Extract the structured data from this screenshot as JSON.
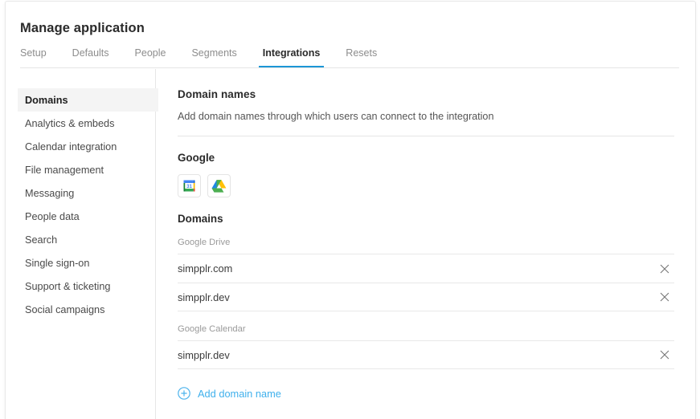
{
  "window": {
    "title": "Manage application"
  },
  "tabs": [
    {
      "label": "Setup",
      "active": false
    },
    {
      "label": "Defaults",
      "active": false
    },
    {
      "label": "People",
      "active": false
    },
    {
      "label": "Segments",
      "active": false
    },
    {
      "label": "Integrations",
      "active": true
    },
    {
      "label": "Resets",
      "active": false
    }
  ],
  "sidebar": {
    "items": [
      {
        "label": "Domains",
        "active": true
      },
      {
        "label": "Analytics & embeds",
        "active": false
      },
      {
        "label": "Calendar integration",
        "active": false
      },
      {
        "label": "File management",
        "active": false
      },
      {
        "label": "Messaging",
        "active": false
      },
      {
        "label": "People data",
        "active": false
      },
      {
        "label": "Search",
        "active": false
      },
      {
        "label": "Single sign-on",
        "active": false
      },
      {
        "label": "Support & ticketing",
        "active": false
      },
      {
        "label": "Social campaigns",
        "active": false
      }
    ]
  },
  "main": {
    "section_title": "Domain names",
    "section_description": "Add domain names through which users can connect to the integration",
    "provider_title": "Google",
    "integration_icons": [
      {
        "name": "google-calendar-icon",
        "label": "Google Calendar"
      },
      {
        "name": "google-drive-icon",
        "label": "Google Drive"
      }
    ],
    "domains_title": "Domains",
    "domain_groups": [
      {
        "label": "Google Drive",
        "rows": [
          {
            "value": "simpplr.com",
            "remove_icon": "close-icon"
          },
          {
            "value": "simpplr.dev",
            "remove_icon": "close-icon"
          }
        ]
      },
      {
        "label": "Google Calendar",
        "rows": [
          {
            "value": "simpplr.dev",
            "remove_icon": "close-icon"
          }
        ]
      }
    ],
    "add_domain": {
      "icon": "plus-circle-icon",
      "label": "Add domain name"
    }
  },
  "colors": {
    "accent_tab_underline": "#1b96d6",
    "accent_link": "#3fb0ec",
    "selected_item_bg": "#f4f4f4",
    "divider": "#e6e6e6",
    "text_primary": "#2b2b2b",
    "text_muted": "#9a9a9a"
  }
}
